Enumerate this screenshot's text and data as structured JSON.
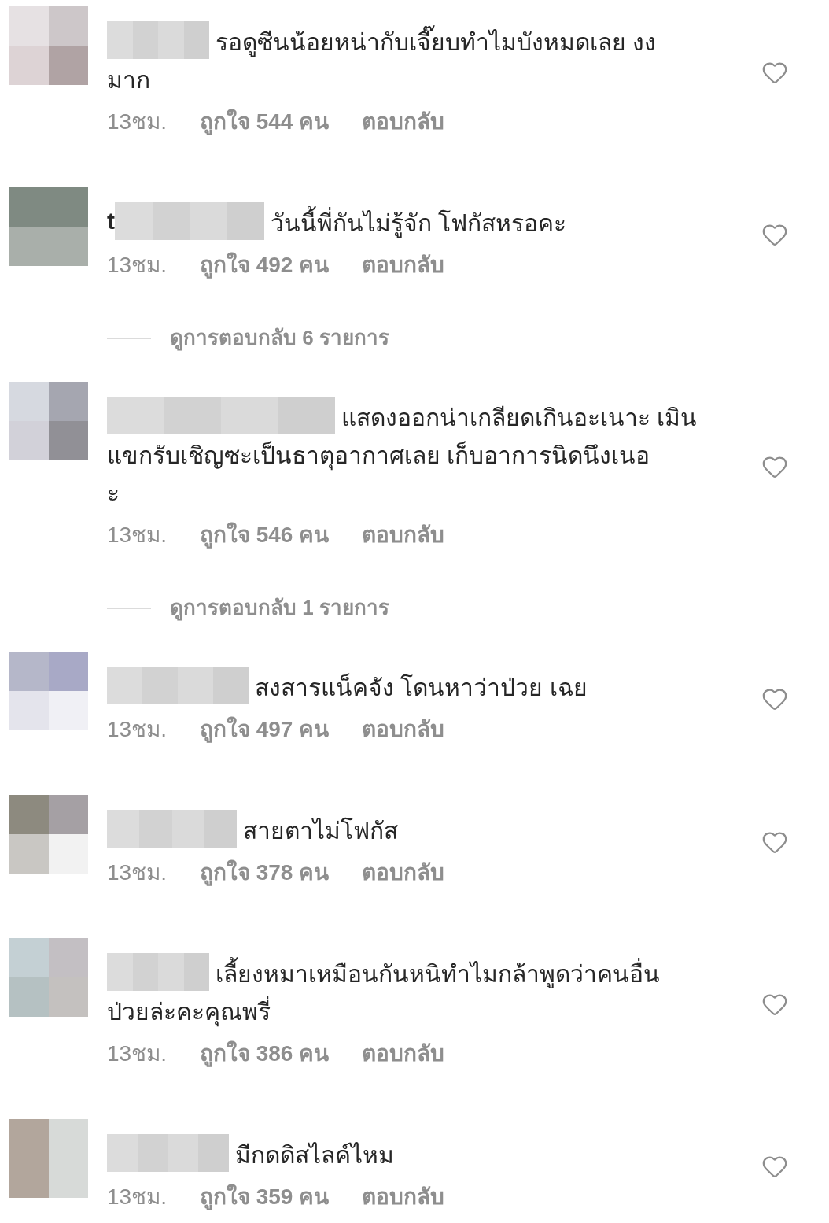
{
  "comments": [
    {
      "lines": [
        "รอดูซีนน้อยหน่ากับเจี๊ยบทำไมบังหมดเลย งง",
        "มาก"
      ],
      "time": "13ชม.",
      "likes": "ถูกใจ 544 คน",
      "reply": "ตอบกลับ"
    },
    {
      "username_visible": "t",
      "lines": [
        "วันนี้พี่กันไม่รู้จัก โฟกัสหรอคะ"
      ],
      "time": "13ชม.",
      "likes": "ถูกใจ 492 คน",
      "reply": "ตอบกลับ",
      "view_replies": "ดูการตอบกลับ 6 รายการ"
    },
    {
      "lines": [
        "แสดงออกน่าเกลียดเกินอะเนาะ เมิน",
        "แขกรับเชิญซะเป็นธาตุอากาศเลย เก็บอาการนิดนึงเนอ",
        "ะ"
      ],
      "time": "13ชม.",
      "likes": "ถูกใจ 546 คน",
      "reply": "ตอบกลับ",
      "view_replies": "ดูการตอบกลับ 1 รายการ"
    },
    {
      "lines": [
        "สงสารแน็คจัง โดนหาว่าป่วย เฉย"
      ],
      "time": "13ชม.",
      "likes": "ถูกใจ 497 คน",
      "reply": "ตอบกลับ"
    },
    {
      "lines": [
        "สายตาไม่โฟกัส"
      ],
      "time": "13ชม.",
      "likes": "ถูกใจ 378 คน",
      "reply": "ตอบกลับ"
    },
    {
      "lines": [
        "เลี้ยงหมาเหมือนกันหนิทำไมกล้าพูดว่าคนอื่น",
        "ป่วยล่ะคะคุณพรี่"
      ],
      "time": "13ชม.",
      "likes": "ถูกใจ 386 คน",
      "reply": "ตอบกลับ"
    },
    {
      "lines": [
        "มีกดดิสไลค์ไหม"
      ],
      "time": "13ชม.",
      "likes": "ถูกใจ 359 คน",
      "reply": "ตอบกลับ"
    }
  ]
}
